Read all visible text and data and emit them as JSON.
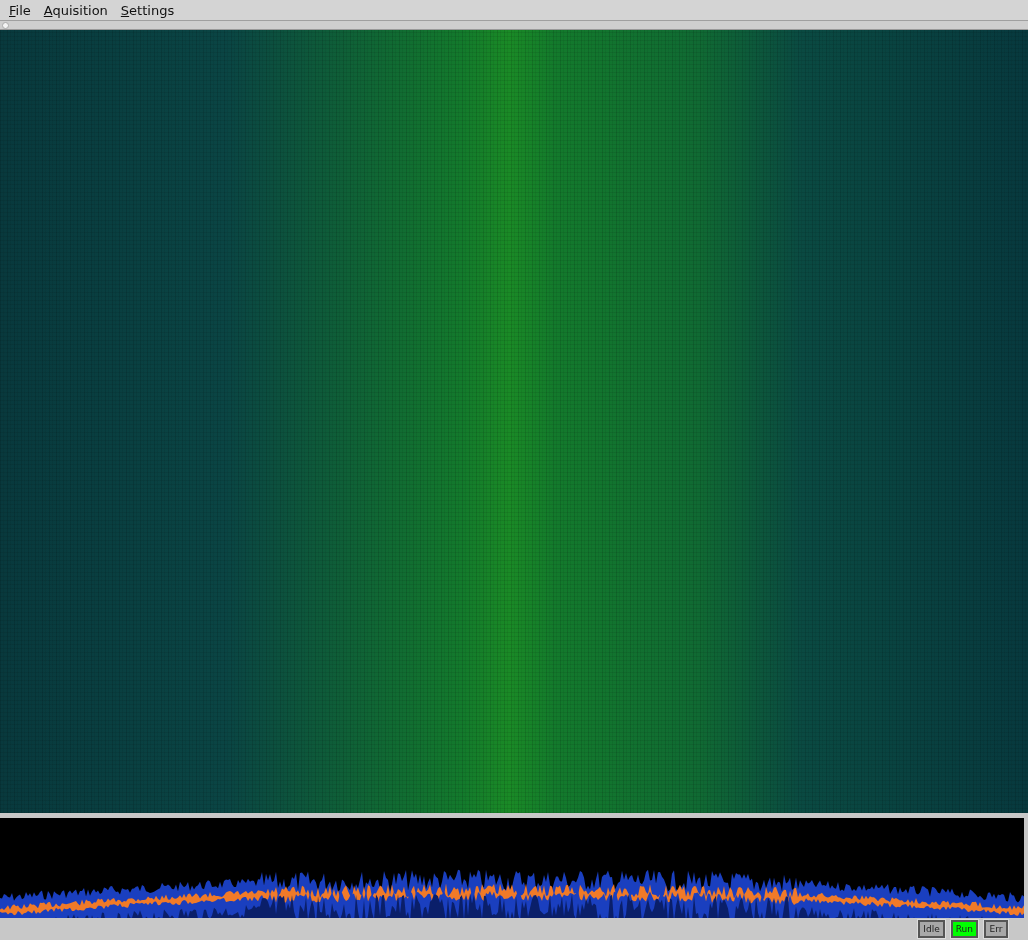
{
  "menu": [
    {
      "label": "File"
    },
    {
      "label": "Aquisition"
    },
    {
      "label": "Settings"
    }
  ],
  "status_indicators": [
    {
      "label": "Idle",
      "on": false
    },
    {
      "label": "Run",
      "on": true
    },
    {
      "label": "Err",
      "on": false
    }
  ]
}
